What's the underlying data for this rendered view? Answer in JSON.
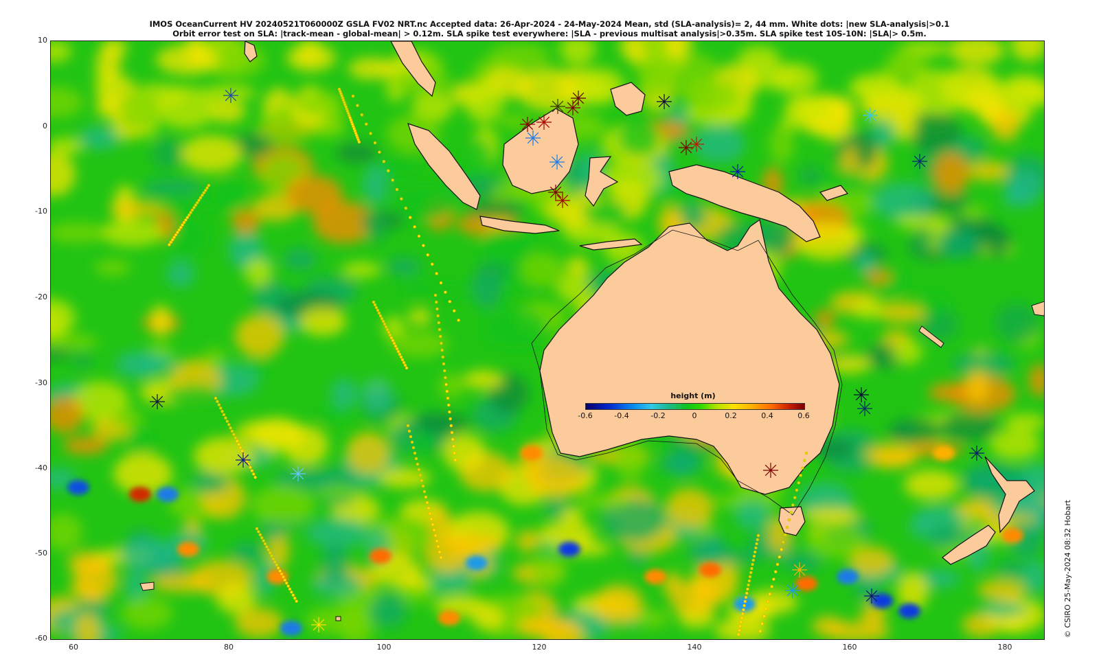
{
  "title": {
    "line1": "IMOS OceanCurrent HV 20240521T060000Z GSLA FV02 NRT.nc  Accepted data: 26-Apr-2024 - 24-May-2024 Mean, std (SLA-analysis)= 2, 44 mm. White dots: |new SLA-analysis|>0.1",
    "line2": "Orbit error test on SLA: |track-mean  - global-mean| > 0.12m.  SLA spike test everywhere: |SLA - previous multisat analysis|>0.35m. SLA spike test 10S-10N: |SLA|> 0.5m."
  },
  "axes": {
    "y_ticks": [
      "10",
      "0",
      "-10",
      "-20",
      "-30",
      "-40",
      "-50",
      "-60"
    ],
    "x_ticks": [
      "60",
      "80",
      "100",
      "120",
      "140",
      "160",
      "180"
    ]
  },
  "colorbar": {
    "title": "height (m)",
    "labels": [
      "-0.6",
      "-0.4",
      "-0.2",
      "0",
      "0.2",
      "0.4",
      "0.6"
    ]
  },
  "credit": "© CSIRO 25-May-2024 08:32 Hobart",
  "colors": {
    "land": "#fccb9c",
    "ocean_base": "#22c414",
    "high": "#d02a00",
    "low": "#0a50e0"
  }
}
